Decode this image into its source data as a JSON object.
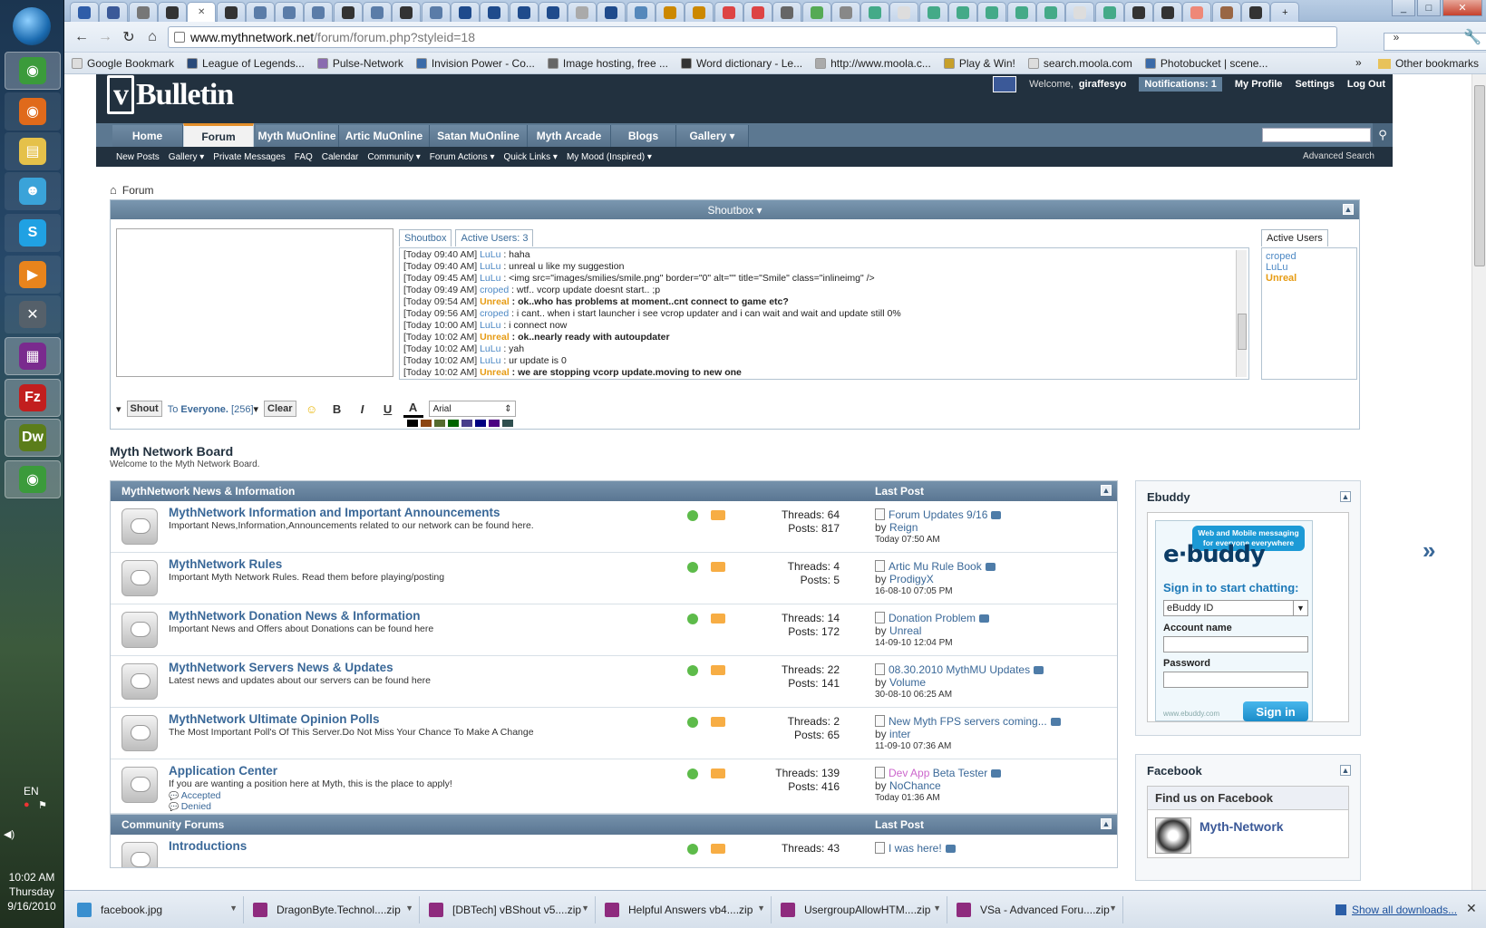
{
  "taskbar": {
    "apps": [
      {
        "name": "chrome-icon",
        "color": "#3b9b3b",
        "glyph": "◉",
        "active": true
      },
      {
        "name": "firefox-icon",
        "color": "#e06a1b",
        "glyph": "◉",
        "active": false
      },
      {
        "name": "explorer-icon",
        "color": "#e5c14a",
        "glyph": "▤",
        "active": false
      },
      {
        "name": "messenger-icon",
        "color": "#3aa3d9",
        "glyph": "☻",
        "active": false
      },
      {
        "name": "skype-icon",
        "color": "#20a1e3",
        "glyph": "S",
        "active": false
      },
      {
        "name": "media-player-icon",
        "color": "#e8841c",
        "glyph": "▶",
        "active": false
      },
      {
        "name": "tool-icon",
        "color": "#55606a",
        "glyph": "✕",
        "active": false
      },
      {
        "name": "winrar-icon",
        "color": "#7a2b8e",
        "glyph": "▦",
        "active": true
      },
      {
        "name": "filezilla-icon",
        "color": "#c21e1e",
        "glyph": "Fz",
        "active": true
      },
      {
        "name": "dreamweaver-icon",
        "color": "#5b7d1a",
        "glyph": "Dw",
        "active": true
      },
      {
        "name": "chrome-icon",
        "color": "#3b9b3b",
        "glyph": "◉",
        "active": true
      }
    ],
    "lang": "EN",
    "time": "10:02 AM",
    "day": "Thursday",
    "date": "9/16/2010"
  },
  "browser": {
    "url_host": "www.mythnetwork.net",
    "url_path": "/forum/forum.php?styleid=18",
    "bookmarks": [
      "Google Bookmark",
      "League of Legends...",
      "Pulse-Network",
      "Invision Power - Co...",
      "Image hosting, free ...",
      "Word dictionary - Le...",
      "http://www.moola.c...",
      "Play & Win!",
      "search.moola.com",
      "Photobucket | scene..."
    ],
    "other_bookmarks": "Other bookmarks"
  },
  "header": {
    "logo": "Bulletin",
    "logo_v": "v",
    "welcome": "Welcome,",
    "username": "giraffesyo",
    "notifications": "Notifications: 1",
    "links": [
      "My Profile",
      "Settings",
      "Log Out"
    ]
  },
  "nav": {
    "tabs": [
      "Home",
      "Forum",
      "Myth MuOnline",
      "Artic MuOnline",
      "Satan MuOnline",
      "Myth Arcade",
      "Blogs",
      "Gallery"
    ],
    "active": "Forum",
    "sub": [
      "New Posts",
      "Gallery ▾",
      "Private Messages",
      "FAQ",
      "Calendar",
      "Community ▾",
      "Forum Actions ▾",
      "Quick Links ▾",
      "My Mood (Inspired) ▾"
    ],
    "advanced_search": "Advanced Search"
  },
  "breadcrumb": "Forum",
  "shoutbox": {
    "title": "Shoutbox",
    "tab_shoutbox": "Shoutbox",
    "tab_active": "Active Users: 3",
    "messages": [
      {
        "t": "[Today 09:40 AM]",
        "u": "LuLu",
        "msg": ": haha",
        "org": false,
        "bold": false
      },
      {
        "t": "[Today 09:40 AM]",
        "u": "LuLu",
        "msg": ": unreal u like my suggestion",
        "org": false,
        "bold": false
      },
      {
        "t": "[Today 09:45 AM]",
        "u": "LuLu",
        "msg": ": <img src=\"images/smilies/smile.png\" border=\"0\" alt=\"\" title=\"Smile\" class=\"inlineimg\" />",
        "org": false,
        "bold": false
      },
      {
        "t": "[Today 09:49 AM]",
        "u": "croped",
        "msg": ": wtf.. vcorp update doesnt start.. ;p",
        "org": false,
        "bold": false
      },
      {
        "t": "[Today 09:54 AM]",
        "u": "Unreal",
        "msg": ": ok..who has problems at moment..cnt connect to game etc?",
        "org": true,
        "bold": true
      },
      {
        "t": "[Today 09:56 AM]",
        "u": "croped",
        "msg": ": i cant.. when i start launcher i see vcrop updater and i can wait and wait and update still 0%",
        "org": false,
        "bold": false
      },
      {
        "t": "[Today 10:00 AM]",
        "u": "LuLu",
        "msg": ": i connect now",
        "org": false,
        "bold": false
      },
      {
        "t": "[Today 10:02 AM]",
        "u": "Unreal",
        "msg": ": ok..nearly ready with autoupdater",
        "org": true,
        "bold": true
      },
      {
        "t": "[Today 10:02 AM]",
        "u": "LuLu",
        "msg": ": yah",
        "org": false,
        "bold": false
      },
      {
        "t": "[Today 10:02 AM]",
        "u": "LuLu",
        "msg": ": ur update is 0",
        "org": false,
        "bold": false
      },
      {
        "t": "[Today 10:02 AM]",
        "u": "Unreal",
        "msg": ": we are stopping vcorp update.moving to new one",
        "org": true,
        "bold": true
      }
    ],
    "active_users_tab": "Active Users",
    "active_users": [
      {
        "name": "croped",
        "org": false
      },
      {
        "name": "LuLu",
        "org": false
      },
      {
        "name": "Unreal",
        "org": true
      }
    ],
    "shout_btn": "Shout",
    "to": "To",
    "everyone": "Everyone.",
    "count": "[256]",
    "clear_btn": "Clear",
    "font": "Arial",
    "swatches": [
      "#000000",
      "#8b4513",
      "#556b2f",
      "#006400",
      "#483d8b",
      "#000080",
      "#4b0082",
      "#2f4f4f"
    ]
  },
  "board": {
    "title": "Myth Network Board",
    "desc": "Welcome to the Myth Network Board."
  },
  "sections": [
    {
      "title": "MythNetwork News & Information",
      "last_post_label": "Last Post",
      "forums": [
        {
          "title": "MythNetwork Information and Important Announcements",
          "desc": "Important News,Information,Announcements related to our network can be found here.",
          "threads": "Threads: 64",
          "posts": "Posts: 817",
          "lp_title": "Forum Updates 9/16",
          "lp_prefix": "",
          "lp_by": "by",
          "lp_user": "Reign",
          "lp_date": "Today 07:50 AM"
        },
        {
          "title": "MythNetwork Rules",
          "desc": "Important Myth Network Rules. Read them before playing/posting",
          "threads": "Threads: 4",
          "posts": "Posts: 5",
          "lp_title": "Artic Mu Rule Book",
          "lp_prefix": "",
          "lp_by": "by",
          "lp_user": "ProdigyX",
          "lp_date": "16-08-10 07:05 PM"
        },
        {
          "title": "MythNetwork Donation News & Information",
          "desc": "Important News and Offers about Donations can be found here",
          "threads": "Threads: 14",
          "posts": "Posts: 172",
          "lp_title": "Donation Problem",
          "lp_prefix": "",
          "lp_by": "by",
          "lp_user": "Unreal",
          "lp_date": "14-09-10 12:04 PM"
        },
        {
          "title": "MythNetwork Servers News & Updates",
          "desc": "Latest news and updates about our servers can be found here",
          "threads": "Threads: 22",
          "posts": "Posts: 141",
          "lp_title": "08.30.2010 MythMU Updates",
          "lp_prefix": "",
          "lp_by": "by",
          "lp_user": "Volume",
          "lp_date": "30-08-10 06:25 AM"
        },
        {
          "title": "MythNetwork Ultimate Opinion Polls",
          "desc": "The Most Important Poll's Of This Server.Do Not Miss Your Chance To Make A Change",
          "threads": "Threads: 2",
          "posts": "Posts: 65",
          "lp_title": "New Myth FPS servers coming...",
          "lp_prefix": "",
          "lp_by": "by",
          "lp_user": "inter",
          "lp_date": "11-09-10 07:36 AM"
        },
        {
          "title": "Application Center",
          "desc": "If you are wanting a position here at Myth, this is the place to apply!",
          "threads": "Threads: 139",
          "posts": "Posts: 416",
          "lp_title": "Beta Tester",
          "lp_prefix": "Dev App",
          "lp_by": "by",
          "lp_user": "NoChance",
          "lp_date": "Today 01:36 AM",
          "subs": [
            "Accepted",
            "Denied"
          ]
        }
      ]
    },
    {
      "title": "Community Forums",
      "last_post_label": "Last Post",
      "forums": [
        {
          "title": "Introductions",
          "desc": "",
          "threads": "Threads: 43",
          "posts": "",
          "lp_title": "I was here!",
          "lp_prefix": "",
          "lp_by": "",
          "lp_user": "",
          "lp_date": ""
        }
      ]
    }
  ],
  "sidebar": {
    "ebuddy": {
      "title": "Ebuddy",
      "bubble": "Web and Mobile messaging for everyone everywhere",
      "logo": "e·buddy",
      "sign_in_heading": "Sign in to start chatting:",
      "select": "eBuddy ID",
      "account_label": "Account name",
      "password_label": "Password",
      "url": "www.ebuddy.com",
      "sign_in_btn": "Sign in"
    },
    "facebook": {
      "title": "Facebook",
      "find": "Find us on Facebook",
      "page": "Myth-Network"
    }
  },
  "downloads": {
    "items": [
      {
        "name": "facebook.jpg",
        "color": "#3a8fcf"
      },
      {
        "name": "DragonByte.Technol....zip",
        "color": "#8e2b7e"
      },
      {
        "name": "[DBTech] vBShout v5....zip",
        "color": "#8e2b7e"
      },
      {
        "name": "Helpful Answers vb4....zip",
        "color": "#8e2b7e"
      },
      {
        "name": "UsergroupAllowHTM....zip",
        "color": "#8e2b7e"
      },
      {
        "name": "VSa - Advanced Foru....zip",
        "color": "#8e2b7e"
      }
    ],
    "show_all": "Show all downloads..."
  }
}
